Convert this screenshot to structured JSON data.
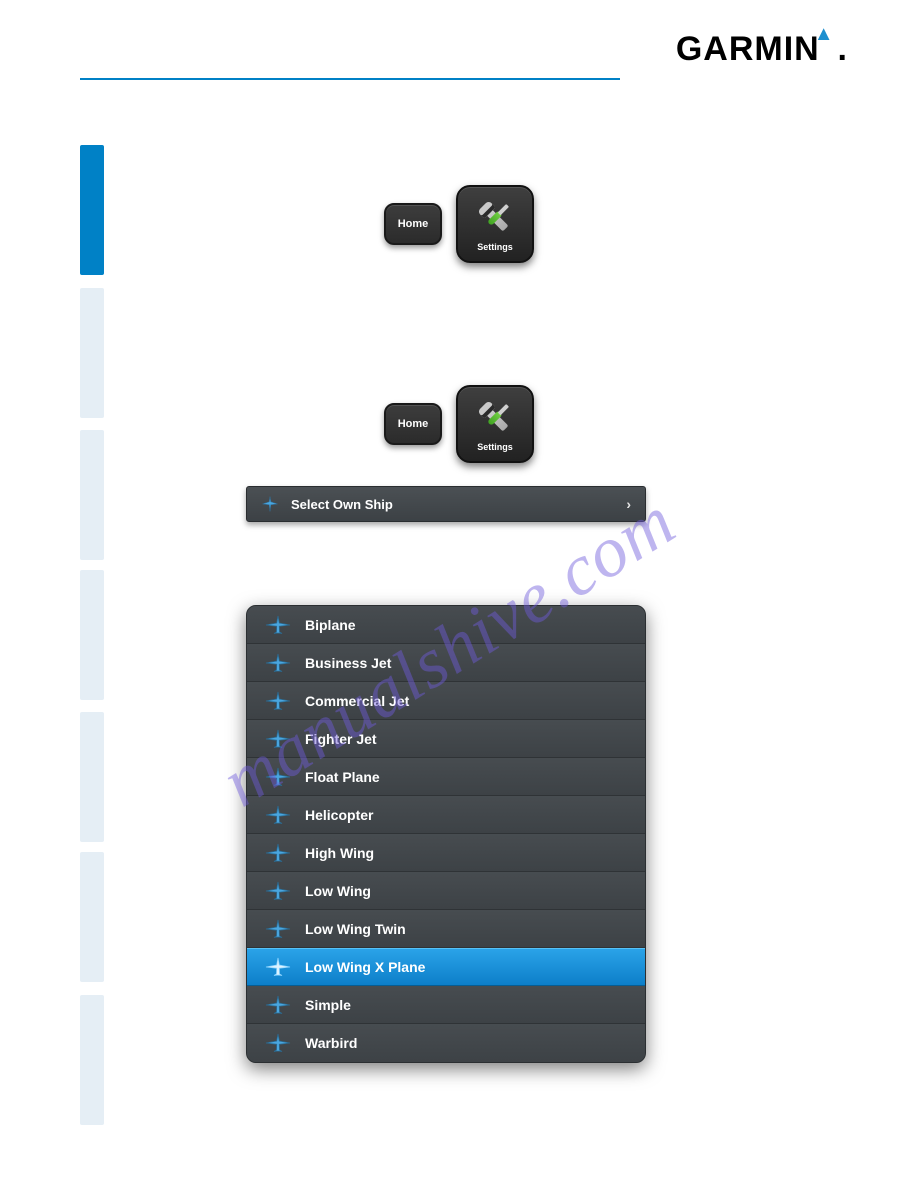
{
  "brand": {
    "name": "GARMIN",
    "dot": "."
  },
  "buttons": {
    "home": "Home",
    "settings": "Settings"
  },
  "select_own_ship": {
    "label": "Select Own Ship"
  },
  "own_ship_list": {
    "items": [
      {
        "label": "Biplane",
        "selected": false
      },
      {
        "label": "Business Jet",
        "selected": false
      },
      {
        "label": "Commercial Jet",
        "selected": false
      },
      {
        "label": "Fighter Jet",
        "selected": false
      },
      {
        "label": "Float Plane",
        "selected": false
      },
      {
        "label": "Helicopter",
        "selected": false
      },
      {
        "label": "High Wing",
        "selected": false
      },
      {
        "label": "Low Wing",
        "selected": false
      },
      {
        "label": "Low Wing Twin",
        "selected": false
      },
      {
        "label": "Low Wing X Plane",
        "selected": true
      },
      {
        "label": "Simple",
        "selected": false
      },
      {
        "label": "Warbird",
        "selected": false
      }
    ]
  },
  "watermark": "manualshive.com"
}
